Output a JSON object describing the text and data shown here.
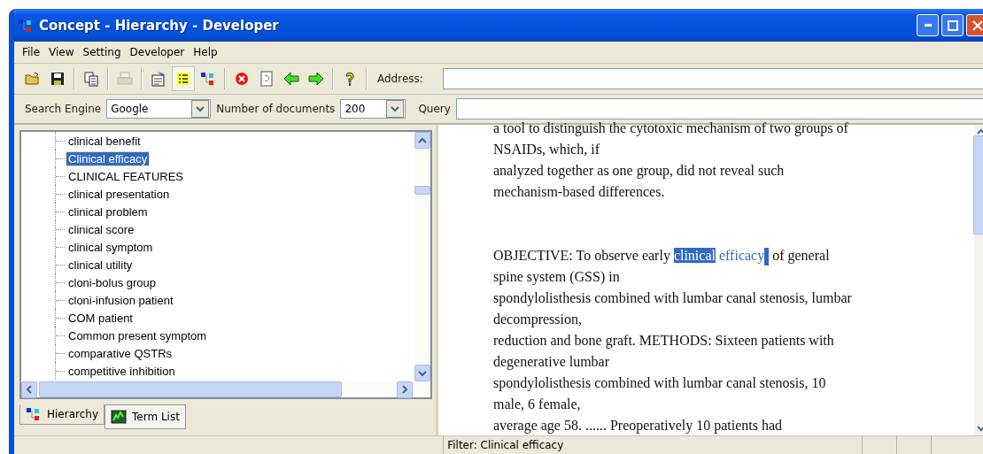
{
  "window": {
    "title": "Concept - Hierarchy  - Developer"
  },
  "menu": [
    "File",
    "View",
    "Setting",
    "Developer",
    "Help"
  ],
  "toolbar": {
    "buttons": [
      {
        "kind": "open",
        "disabled": false,
        "pressed": false
      },
      {
        "kind": "save",
        "disabled": false,
        "pressed": false
      },
      {
        "kind": "sep"
      },
      {
        "kind": "copy",
        "disabled": false,
        "pressed": false
      },
      {
        "kind": "sep"
      },
      {
        "kind": "print",
        "disabled": true,
        "pressed": false
      },
      {
        "kind": "sep"
      },
      {
        "kind": "properties",
        "disabled": false,
        "pressed": false
      },
      {
        "kind": "list",
        "disabled": false,
        "pressed": true
      },
      {
        "kind": "hierarchy",
        "disabled": false,
        "pressed": false
      },
      {
        "kind": "sep"
      },
      {
        "kind": "stop",
        "disabled": false,
        "pressed": false
      },
      {
        "kind": "refresh",
        "disabled": false,
        "pressed": false
      },
      {
        "kind": "back",
        "disabled": false,
        "pressed": false
      },
      {
        "kind": "forward",
        "disabled": false,
        "pressed": false
      },
      {
        "kind": "sep"
      },
      {
        "kind": "help",
        "disabled": false,
        "pressed": false
      },
      {
        "kind": "sep"
      }
    ],
    "address_label": "Address:"
  },
  "search": {
    "engine_label": "Search Engine",
    "engine": "Google",
    "count_label": "Number of documents",
    "count": "200",
    "query_label": "Query"
  },
  "tree": {
    "items": [
      {
        "label": "clinical benefit",
        "selected": false
      },
      {
        "label": "Clinical efficacy",
        "selected": true
      },
      {
        "label": "CLINICAL FEATURES",
        "selected": false
      },
      {
        "label": "clinical presentation",
        "selected": false
      },
      {
        "label": "clinical problem",
        "selected": false
      },
      {
        "label": "clinical score",
        "selected": false
      },
      {
        "label": "clinical symptom",
        "selected": false
      },
      {
        "label": "clinical utility",
        "selected": false
      },
      {
        "label": "cloni-bolus group",
        "selected": false
      },
      {
        "label": "cloni-infusion patient",
        "selected": false
      },
      {
        "label": "COM patient",
        "selected": false
      },
      {
        "label": "Common present symptom",
        "selected": false
      },
      {
        "label": "comparative QSTRs",
        "selected": false
      },
      {
        "label": "competitive inhibition",
        "selected": false
      }
    ]
  },
  "tabs": [
    {
      "label": "Hierarchy",
      "kind": "hierarchy",
      "selected": true
    },
    {
      "label": "Term List",
      "kind": "terms",
      "selected": false
    }
  ],
  "document": {
    "paragraphs": [
      {
        "lines": [
          [
            {
              "kind": "plain",
              "text": "a tool to distinguish the cytotoxic mechanism of two groups of"
            }
          ],
          [
            {
              "kind": "plain",
              "text": "NSAIDs, which, if"
            }
          ],
          [
            {
              "kind": "plain",
              "text": "analyzed together as one group, did not reveal such"
            }
          ],
          [
            {
              "kind": "plain",
              "text": "mechanism-based differences."
            }
          ]
        ]
      },
      {
        "lines": [
          [
            {
              "kind": "plain",
              "text": "OBJECTIVE: To observe early "
            },
            {
              "kind": "selected",
              "text": "clinical"
            },
            {
              "kind": "match",
              "text": "efficacy"
            },
            {
              "kind": "caret"
            },
            {
              "kind": "plain",
              "text": " of general"
            }
          ],
          [
            {
              "kind": "plain",
              "text": "spine system (GSS) in"
            }
          ],
          [
            {
              "kind": "plain",
              "text": "spondylolisthesis combined with lumbar canal stenosis, lumbar"
            }
          ],
          [
            {
              "kind": "plain",
              "text": "decompression,"
            }
          ],
          [
            {
              "kind": "plain",
              "text": "reduction and bone graft. METHODS: Sixteen patients with"
            }
          ],
          [
            {
              "kind": "plain",
              "text": "degenerative lumbar"
            }
          ],
          [
            {
              "kind": "plain",
              "text": "spondylolisthesis combined with lumbar canal stenosis, 10"
            }
          ],
          [
            {
              "kind": "plain",
              "text": "male, 6 female,"
            }
          ],
          [
            {
              "kind": "plain",
              "text": "average age 58. ...... Preoperatively 10 patients had"
            }
          ]
        ]
      }
    ]
  },
  "status_bar": {
    "text": "Filter: Clinical efficacy"
  }
}
